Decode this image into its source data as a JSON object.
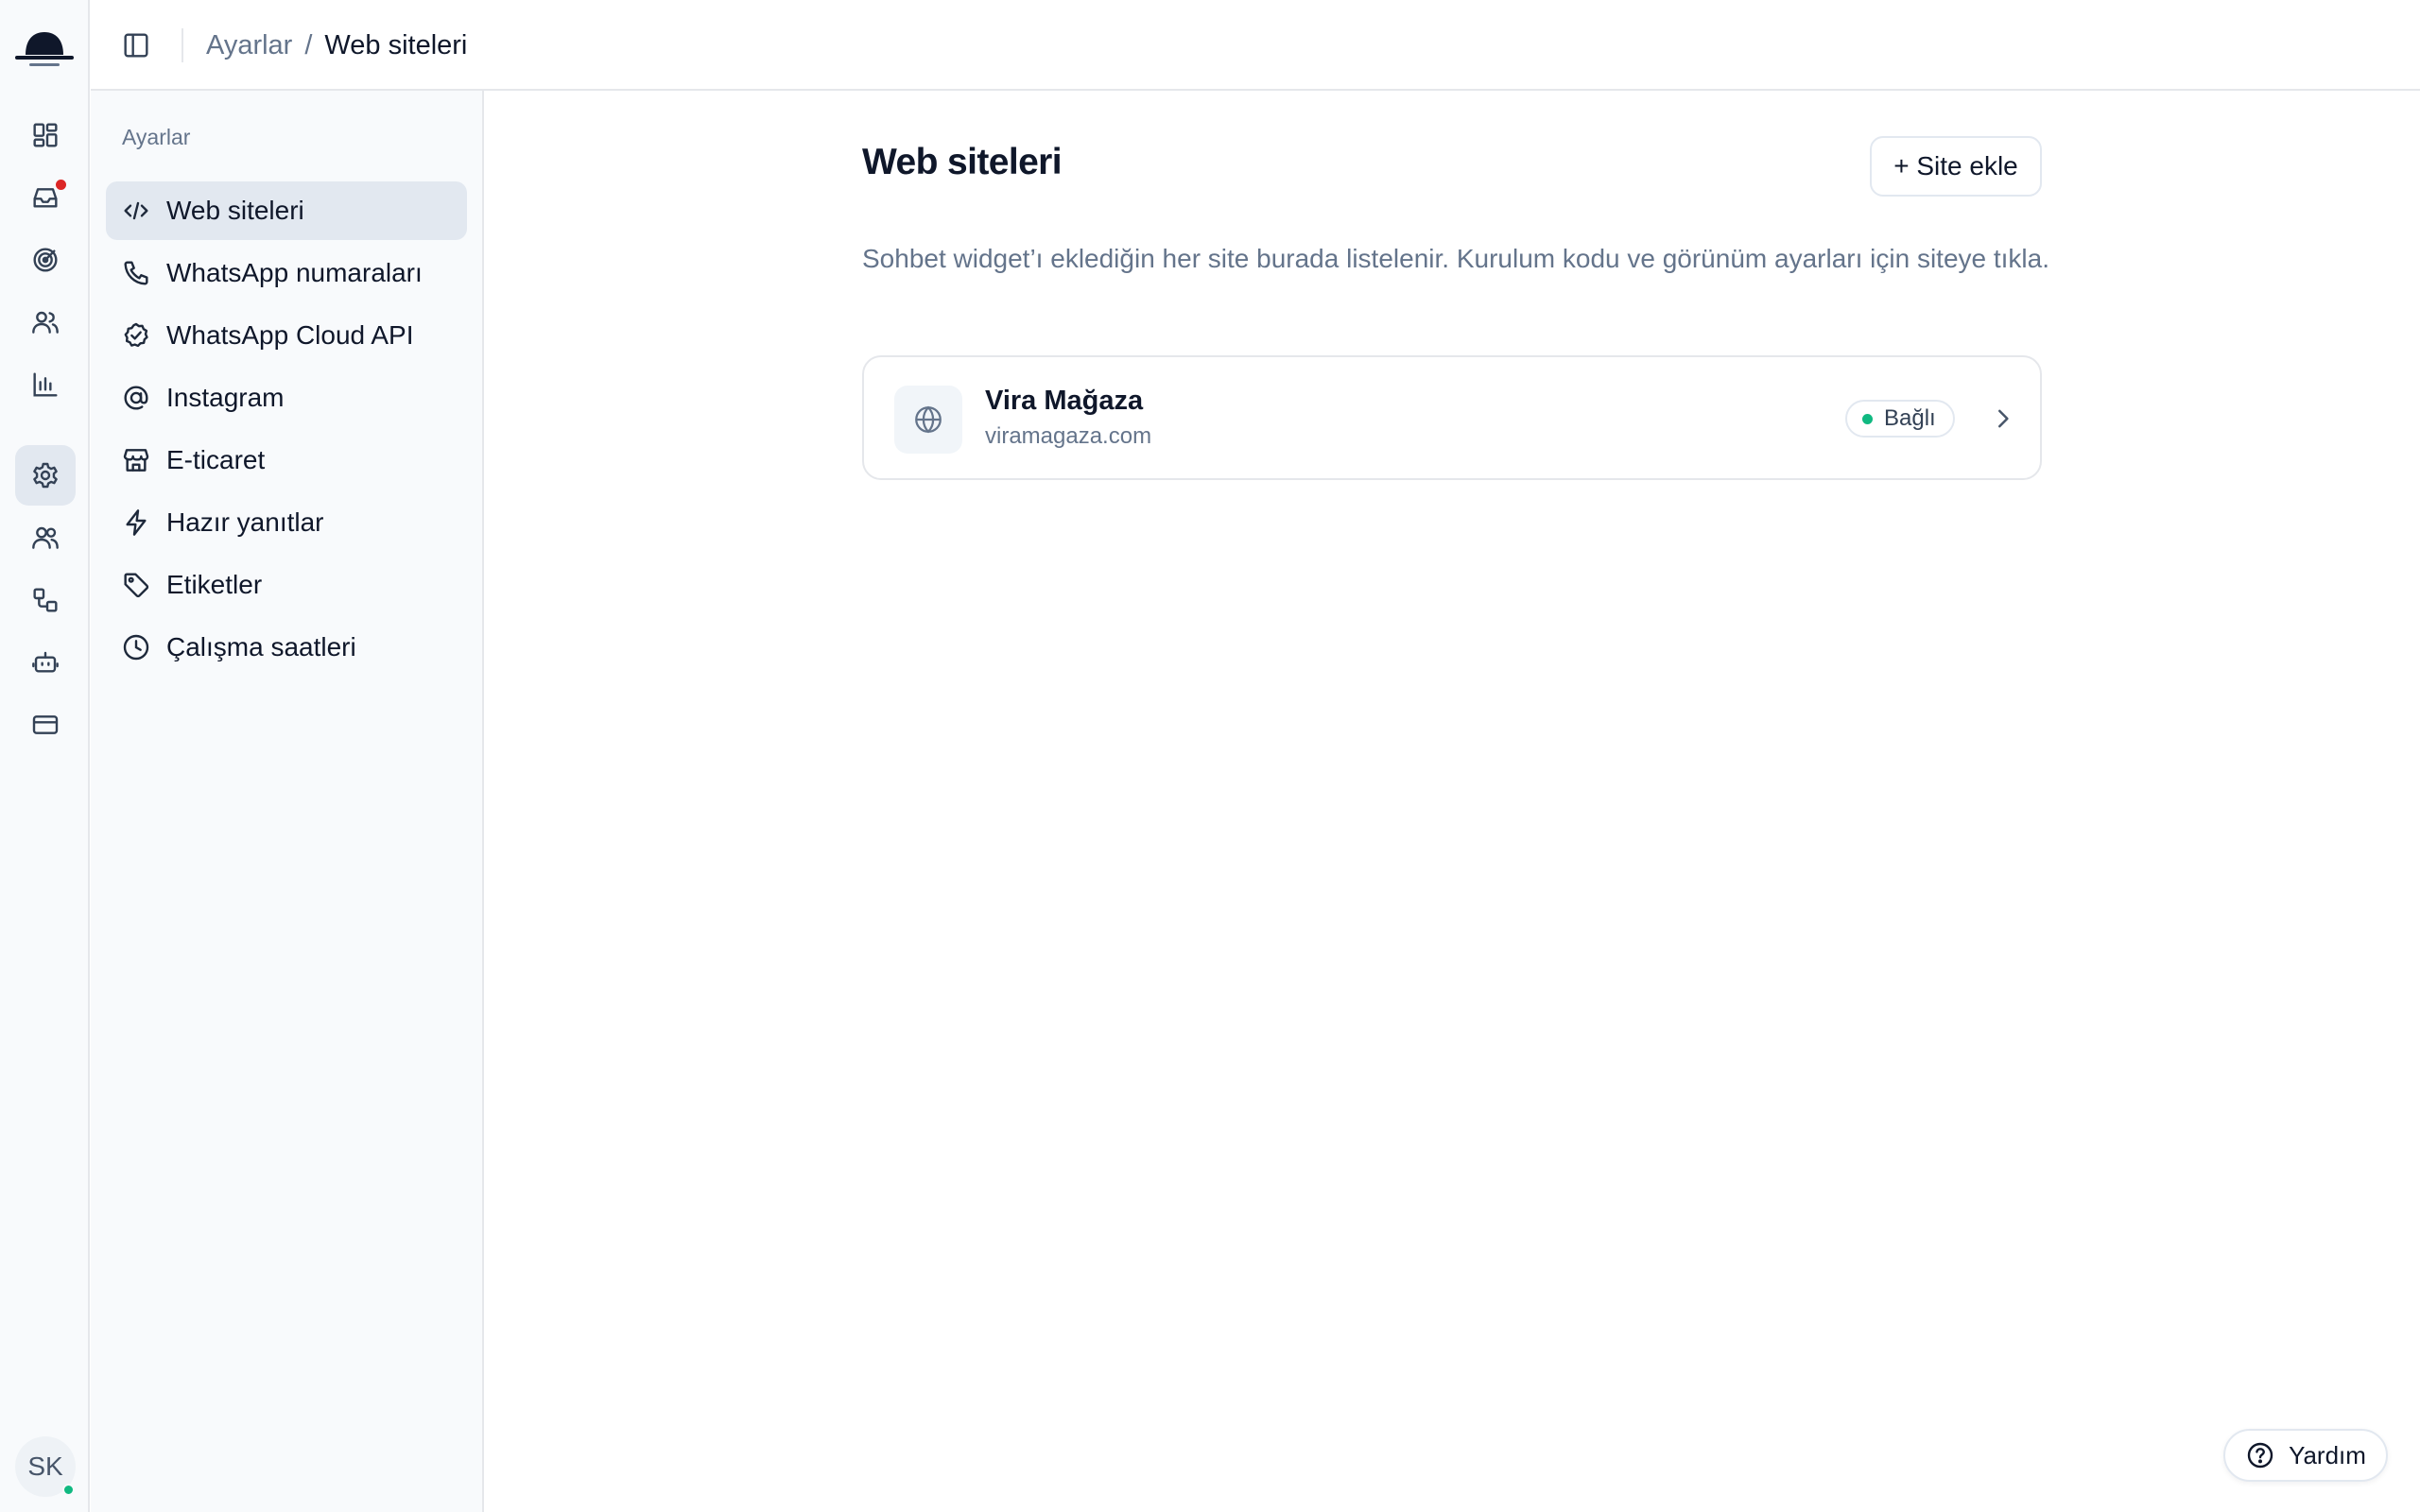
{
  "app": {
    "logo_icon": "hat-logo-icon"
  },
  "rail": {
    "items": [
      {
        "icon": "dashboard-icon"
      },
      {
        "icon": "inbox-icon",
        "badge_color": "#dc2626"
      },
      {
        "icon": "target-icon"
      },
      {
        "icon": "contacts-icon"
      },
      {
        "icon": "chart-bar-icon"
      },
      {
        "icon": "gear-icon",
        "active": true
      },
      {
        "icon": "team-icon"
      },
      {
        "icon": "workflow-icon"
      },
      {
        "icon": "bot-icon"
      },
      {
        "icon": "credit-card-icon"
      }
    ],
    "avatar": {
      "initials": "SK",
      "status_color": "#10b981"
    }
  },
  "topbar": {
    "toggle_icon": "sidebar-toggle-icon",
    "breadcrumb": {
      "parent": "Ayarlar",
      "separator": "/",
      "current": "Web siteleri"
    }
  },
  "settings_nav": {
    "heading": "Ayarlar",
    "items": [
      {
        "label": "Web siteleri",
        "icon": "code-icon",
        "active": true
      },
      {
        "label": "WhatsApp numaraları",
        "icon": "phone-icon"
      },
      {
        "label": "WhatsApp Cloud API",
        "icon": "badge-check-icon"
      },
      {
        "label": "Instagram",
        "icon": "at-sign-icon"
      },
      {
        "label": "E-ticaret",
        "icon": "store-icon"
      },
      {
        "label": "Hazır yanıtlar",
        "icon": "lightning-icon"
      },
      {
        "label": "Etiketler",
        "icon": "tag-icon"
      },
      {
        "label": "Çalışma saatleri",
        "icon": "clock-icon"
      }
    ]
  },
  "main": {
    "title": "Web siteleri",
    "add_button": "+ Site ekle",
    "description": "Sohbet widget’ı eklediğin her site burada listelenir. Kurulum kodu ve görünüm ayarları için siteye tıkla.",
    "sites": [
      {
        "name": "Vira Mağaza",
        "domain": "viramagaza.com",
        "status": "Bağlı",
        "status_color": "#10b981",
        "icon": "globe-icon"
      }
    ]
  },
  "help": {
    "label": "Yardım",
    "icon": "help-circle-icon"
  }
}
